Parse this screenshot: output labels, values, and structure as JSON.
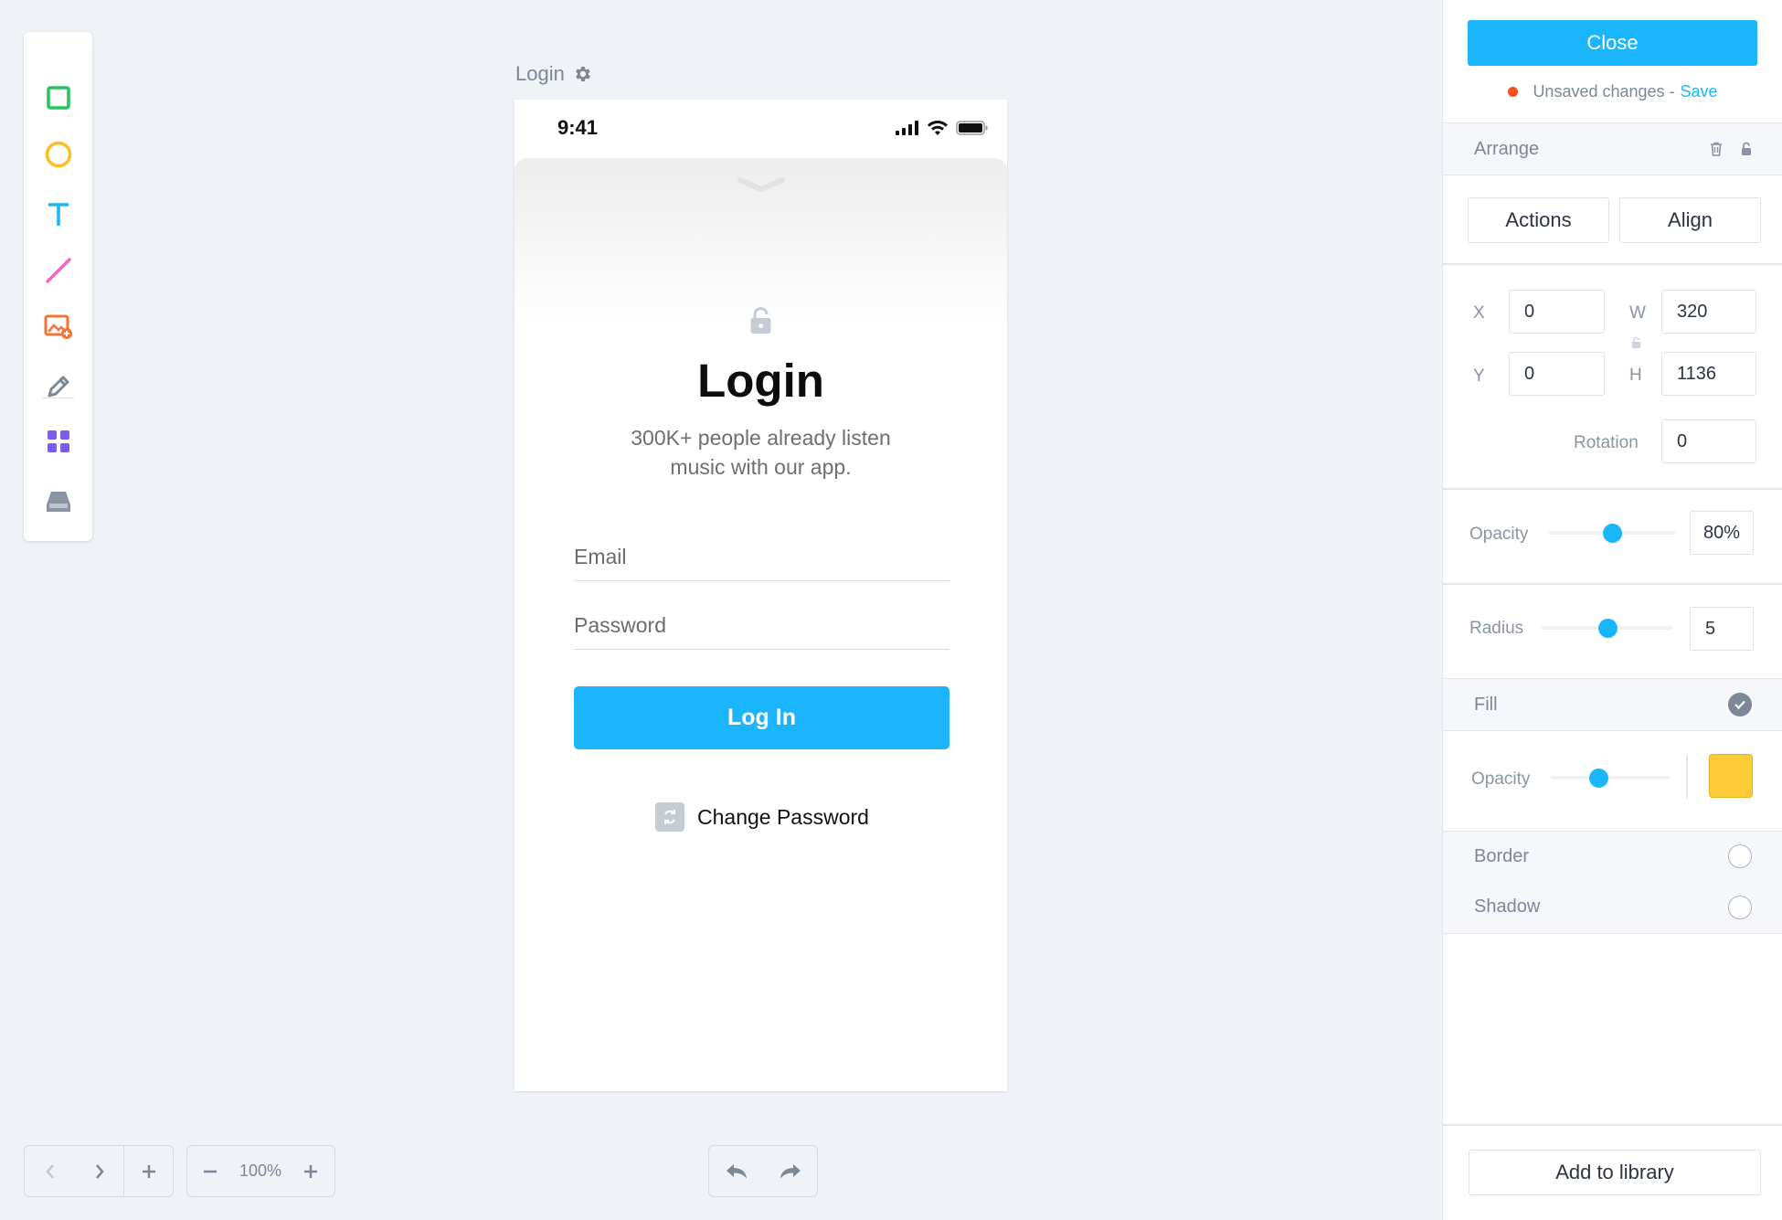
{
  "toolbar": {
    "tools": [
      {
        "name": "rectangle-tool",
        "icon": "square-icon",
        "color": "#22c55e"
      },
      {
        "name": "ellipse-tool",
        "icon": "circle-icon",
        "color": "#fbbf24"
      },
      {
        "name": "text-tool",
        "icon": "text-icon",
        "color": "#1ab5fb"
      },
      {
        "name": "line-tool",
        "icon": "line-icon",
        "color": "#ff5fc8"
      },
      {
        "name": "image-tool",
        "icon": "image-icon",
        "color": "#f4743b"
      },
      {
        "name": "pen-tool",
        "icon": "pencil-icon",
        "color": "#7d8796"
      },
      {
        "name": "components-tool",
        "icon": "grid-icon",
        "color": "#7c5cf0"
      },
      {
        "name": "library-tool",
        "icon": "tray-icon",
        "color": "#8a94a3"
      }
    ]
  },
  "artboard": {
    "name": "Login",
    "status_time": "9:41",
    "title": "Login",
    "subtitle_line1": "300K+ people already listen",
    "subtitle_line2": "music with our app.",
    "email_placeholder": "Email",
    "password_placeholder": "Password",
    "login_button": "Log In",
    "change_password": "Change Password"
  },
  "bottom_controls": {
    "zoom": "100%"
  },
  "panel": {
    "close_label": "Close",
    "unsaved_text": "Unsaved changes -",
    "save_label": "Save",
    "arrange_label": "Arrange",
    "actions_label": "Actions",
    "align_label": "Align",
    "x_label": "X",
    "x_value": "0",
    "y_label": "Y",
    "y_value": "0",
    "w_label": "W",
    "w_value": "320",
    "h_label": "H",
    "h_value": "1136",
    "rotation_label": "Rotation",
    "rotation_value": "0",
    "opacity_label": "Opacity",
    "opacity_value": "80%",
    "radius_label": "Radius",
    "radius_value": "5",
    "fill_label": "Fill",
    "fill_opacity_label": "Opacity",
    "fill_color": "#fdcb35",
    "border_label": "Border",
    "shadow_label": "Shadow",
    "add_library_label": "Add to library"
  },
  "colors": {
    "accent": "#1ab5fb",
    "unsaved_dot": "#f0521e"
  }
}
